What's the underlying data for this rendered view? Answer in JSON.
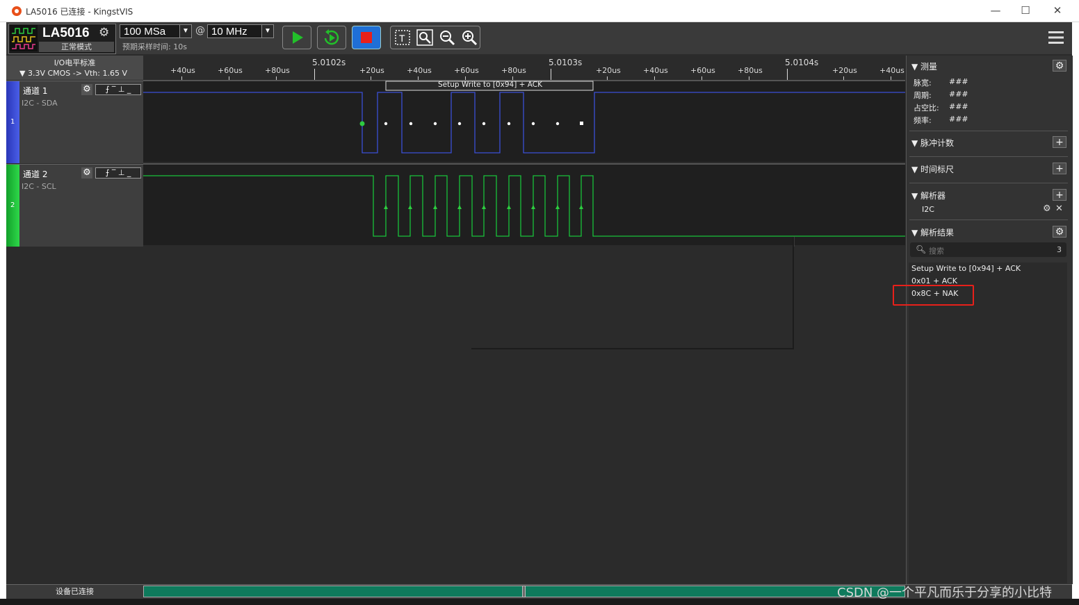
{
  "window": {
    "title": "LA5016 已连接 - KingstVIS",
    "minimize": "—",
    "maximize": "☐",
    "close": "✕"
  },
  "toolbar": {
    "device_name": "LA5016",
    "device_mode": "正常模式",
    "sample_rate": "100 MSa",
    "at_sign": "@",
    "sample_freq": "10 MHz",
    "sample_time": "预期采样时间: 10s"
  },
  "io": {
    "title": "I/O电平标准",
    "value": "▼  3.3V CMOS  -> Vth: 1.65 V"
  },
  "ruler": {
    "minor": [
      "+40us",
      "+60us",
      "+80us",
      "+20us",
      "+40us",
      "+60us",
      "+80us",
      "+20us",
      "+40us",
      "+60us",
      "+80us",
      "+20us",
      "+40us"
    ],
    "major": [
      "5.0102s",
      "5.0103s",
      "5.0104s"
    ]
  },
  "channels": [
    {
      "num": "1",
      "name": "通道 1",
      "sub": "I2C - SDA",
      "color": "#3b4fd6"
    },
    {
      "num": "2",
      "name": "通道 2",
      "sub": "I2C - SCL",
      "color": "#19c23a"
    }
  ],
  "decode_bubble": "Setup Write to [0x94] + ACK",
  "right_panel": {
    "measure": {
      "title": "测量",
      "rows": [
        {
          "label": "脉宽:",
          "value": "###"
        },
        {
          "label": "周期:",
          "value": "###"
        },
        {
          "label": "占空比:",
          "value": "###"
        },
        {
          "label": "频率:",
          "value": "###"
        }
      ]
    },
    "pulse_count": "脉冲计数",
    "time_ruler": "时间标尺",
    "analyzer": {
      "title": "解析器",
      "item": "I2C"
    },
    "results": {
      "title": "解析结果",
      "search_placeholder": "搜索",
      "count": "3",
      "items": [
        "Setup Write to [0x94] + ACK",
        "0x01 + ACK",
        "0x8C + NAK"
      ]
    }
  },
  "status": {
    "connected": "设备已连接"
  },
  "watermark": "CSDN @一个平凡而乐于分享的小比特"
}
